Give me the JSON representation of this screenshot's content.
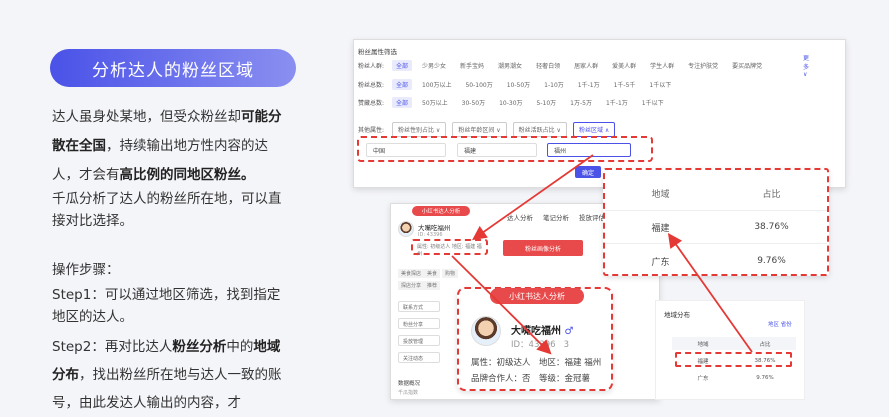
{
  "left": {
    "title": "分析达人的粉丝区域",
    "p1_a": "达人虽身处某地，但受众粉丝却",
    "p1_b": "可能分散在全国",
    "p1_c": "，持续输出地方性内容的达人，才会有",
    "p1_d": "高比例的同地区粉丝。",
    "p2": "千瓜分析了达人的粉丝所在地，可以直接对比选择。",
    "p3": "操作步骤：",
    "p4": "Step1：可以通过地区筛选，找到指定地区的达人。",
    "p5_a": "Step2：再对比达人",
    "p5_b": "粉丝分析",
    "p5_c": "中的",
    "p5_d": "地域分布",
    "p5_e": "，找出粉丝所在地与达人一致的账号，由此发达人输出的内容，才"
  },
  "filter": {
    "header": "粉丝属性筛选",
    "rows": [
      {
        "label": "粉丝人群:",
        "options": [
          "全部",
          "少男少女",
          "新手宝妈",
          "潮男潮女",
          "轻奢白领",
          "居家人群",
          "爱美人群",
          "学生人群",
          "专注护肤党",
          "要买品牌党"
        ],
        "more": "更多 ∨"
      },
      {
        "label": "粉丝总数:",
        "options": [
          "全部",
          "100万以上",
          "50-100万",
          "10-50万",
          "1-10万",
          "1千-1万",
          "1千-5千",
          "1千以下"
        ]
      },
      {
        "label": "赞藏总数:",
        "options": [
          "全部",
          "50万以上",
          "30-50万",
          "10-30万",
          "5-10万",
          "1万-5万",
          "1千-1万",
          "1千以下"
        ]
      }
    ],
    "row4_label": "其他属性:",
    "row4_selects": [
      "粉丝性别占比 ∨",
      "粉丝年龄区间 ∨",
      "粉丝活跃占比 ∨",
      "粉丝区域 ∧"
    ],
    "region_selects": [
      "中国",
      "福建",
      "福州"
    ],
    "confirm": "确定"
  },
  "profile": {
    "badge": "小红书达人分析",
    "name": "大嘴吃福州",
    "id_short": "ID: 43396",
    "attr_line": "属性: 初级达人 地区: 福建 福州",
    "tabs": [
      "达人分析",
      "笔记分析",
      "投放评估"
    ],
    "fans_btn": "粉丝画像分析",
    "side_buttons": [
      "联系方式",
      "粉丝分享",
      "投放管理",
      "关注动态"
    ],
    "tags": [
      "美食探店",
      "美食",
      "购物",
      "探店分享",
      "推荐"
    ],
    "stats_label": "数据概况",
    "stats_sub": "千瓜指数"
  },
  "card": {
    "badge": "小红书达人分析",
    "name": "大嘴吃福州",
    "gender": "♂",
    "id": "ID：43396",
    "id_tail": "3",
    "attr": "属性：初级达人",
    "region": "地区：福建 福州",
    "brand": "品牌合作人：否",
    "level": "等级：金冠薯"
  },
  "region_panel": {
    "title": "地域分布",
    "links": "地区 省份",
    "headers": [
      "地域",
      "占比"
    ],
    "rows": [
      [
        "福建",
        "38.76%"
      ],
      [
        "广东",
        "9.76%"
      ]
    ]
  },
  "zoom": {
    "headers": [
      "地域",
      "占比"
    ],
    "rows": [
      [
        "福建",
        "38.76%"
      ],
      [
        "广东",
        "9.76%"
      ]
    ]
  },
  "colors": {
    "accent": "#4a52e8",
    "highlight": "#e53935",
    "badge": "#e8494a"
  }
}
